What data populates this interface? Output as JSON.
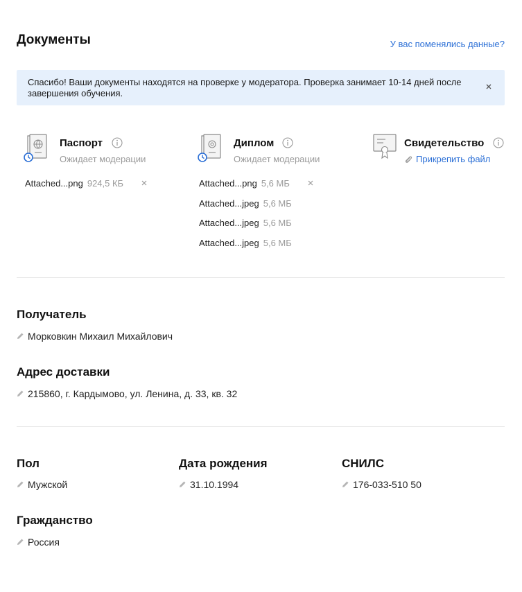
{
  "documents": {
    "title": "Документы",
    "changed_link": "У вас поменялись данные?",
    "notice": "Спасибо! Ваши документы находятся на проверке у модератора. Проверка занимает 10-14 дней после завершения обучения.",
    "items": [
      {
        "title": "Паспорт",
        "status": "Ожидает модерации",
        "icon": "passport-icon",
        "files": [
          {
            "name": "Attached...png",
            "size": "924,5 КБ"
          }
        ]
      },
      {
        "title": "Диплом",
        "status": "Ожидает модерации",
        "icon": "diploma-icon",
        "files": [
          {
            "name": "Attached...png",
            "size": "5,6 МБ"
          },
          {
            "name": "Attached...jpeg",
            "size": "5,6 МБ"
          },
          {
            "name": "Attached...jpeg",
            "size": "5,6 МБ"
          },
          {
            "name": "Attached...jpeg",
            "size": "5,6 МБ"
          }
        ]
      },
      {
        "title": "Свидетельство",
        "attach_label": "Прикрепить файл",
        "icon": "certificate-icon"
      }
    ]
  },
  "recipient": {
    "title": "Получатель",
    "value": "Морковкин Михаил Михайлович"
  },
  "address": {
    "title": "Адрес доставки",
    "value": "215860, г. Кардымово, ул. Ленина, д. 33, кв. 32"
  },
  "personal": {
    "gender": {
      "title": "Пол",
      "value": "Мужской"
    },
    "birthdate": {
      "title": "Дата рождения",
      "value": "31.10.1994"
    },
    "snils": {
      "title": "СНИЛС",
      "value": "176-033-510 50"
    },
    "citizenship": {
      "title": "Гражданство",
      "value": "Россия"
    }
  },
  "colors": {
    "accent": "#2b6fd6",
    "notice_bg": "#e6f0fc",
    "muted": "#9a9a9a",
    "clock": "#2b6fd6"
  }
}
